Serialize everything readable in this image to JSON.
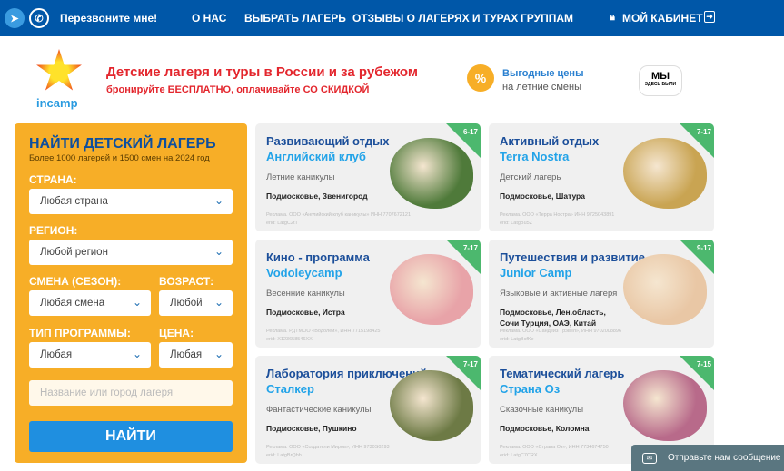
{
  "nav": {
    "callback": "Перезвоните мне!",
    "items": [
      "О НАС",
      "ВЫБРАТЬ ЛАГЕРЬ",
      "ОТЗЫВЫ О ЛАГЕРЯХ И ТУРАХ",
      "ГРУППАМ"
    ],
    "cabinet": "МОЙ КАБИНЕТ"
  },
  "header": {
    "brand": "incamp",
    "title": "Детские лагеря и туры в России и за рубежом",
    "subtitle": "бронируйте БЕСПЛАТНО, оплачивайте СО СКИДКОЙ",
    "promo_title": "Выгодные цены",
    "promo_sub": "на летние смены",
    "promo_icon": "%",
    "badge_main": "МЫ",
    "badge_sub": "ЗДЕСЬ БЫЛИ"
  },
  "search": {
    "title": "НАЙТИ ДЕТСКИЙ ЛАГЕРЬ",
    "subtitle": "Более 1000 лагерей и 1500 смен на 2024 год",
    "country_label": "СТРАНА:",
    "country": "Любая страна",
    "region_label": "РЕГИОН:",
    "region": "Любой регион",
    "season_label": "СМЕНА (СЕЗОН):",
    "season": "Любая смена",
    "age_label": "ВОЗРАСТ:",
    "age": "Любой",
    "type_label": "ТИП ПРОГРАММЫ:",
    "type": "Любая",
    "price_label": "ЦЕНА:",
    "price": "Любая",
    "name_placeholder": "Название или город лагеря",
    "submit": "НАЙТИ"
  },
  "cards": [
    {
      "title": "Развивающий отдых",
      "name": "Английский клуб",
      "type": "Летние каникулы",
      "location": "Подмосковье, Звенигород",
      "ad": "Реклама. ООО «Английский клуб каникулы» ИНН 7707672121",
      "erid": "erid: LatgC2tT",
      "age": "6-17",
      "photo": "#4f7a3a"
    },
    {
      "title": "Активный отдых",
      "name": "Terra Nostra",
      "type": "Детский лагерь",
      "location": "Подмосковье, Шатура",
      "ad": "Реклама. ООО «Терра Ностра» ИНН 9725043891",
      "erid": "erid: LatgBu5Z",
      "age": "7-17",
      "photo": "#c9a452"
    },
    {
      "title": "Кино - программа",
      "name": "Vodoleycamp",
      "type": "Весенние каникулы",
      "location": "Подмосковье, Истра",
      "ad": "Реклама. РДТМОО «Водолей», ИНН 7715198425",
      "erid": "erid: X123658546XX",
      "age": "7-17",
      "photo": "#e8a3a8"
    },
    {
      "title": "Путешествия и развитие",
      "name": "Junior Camp",
      "type": "Языковые и активные лагеря",
      "location": "Подмосковье, Лен.область, Сочи Турция, ОАЭ, Китай",
      "ad": "Реклама. ООО «Сандейз Трэвел», ИНН 9702008896",
      "erid": "erid: LatgBcfKe",
      "age": "9-17",
      "photo": "#e9c7a5"
    },
    {
      "title": "Лаборатория приключений",
      "name": "Сталкер",
      "type": "Фантастические каникулы",
      "location": "Подмосковье, Пушкино",
      "ad": "Реклама. ООО «Создатели Миров», ИНН 9730S0293",
      "erid": "erid: LatgBrQhh",
      "age": "7-17",
      "photo": "#6d7a45"
    },
    {
      "title": "Тематический лагерь",
      "name": "Страна Оз",
      "type": "Сказочные каникулы",
      "location": "Подмосковье, Коломна",
      "ad": "Реклама. ООО «Страна Оз», ИНН 7734674750",
      "erid": "erid: LatgC7CRX",
      "age": "7-15",
      "photo": "#b86a8a"
    }
  ],
  "chat": {
    "label": "Отправьте нам сообщение"
  }
}
